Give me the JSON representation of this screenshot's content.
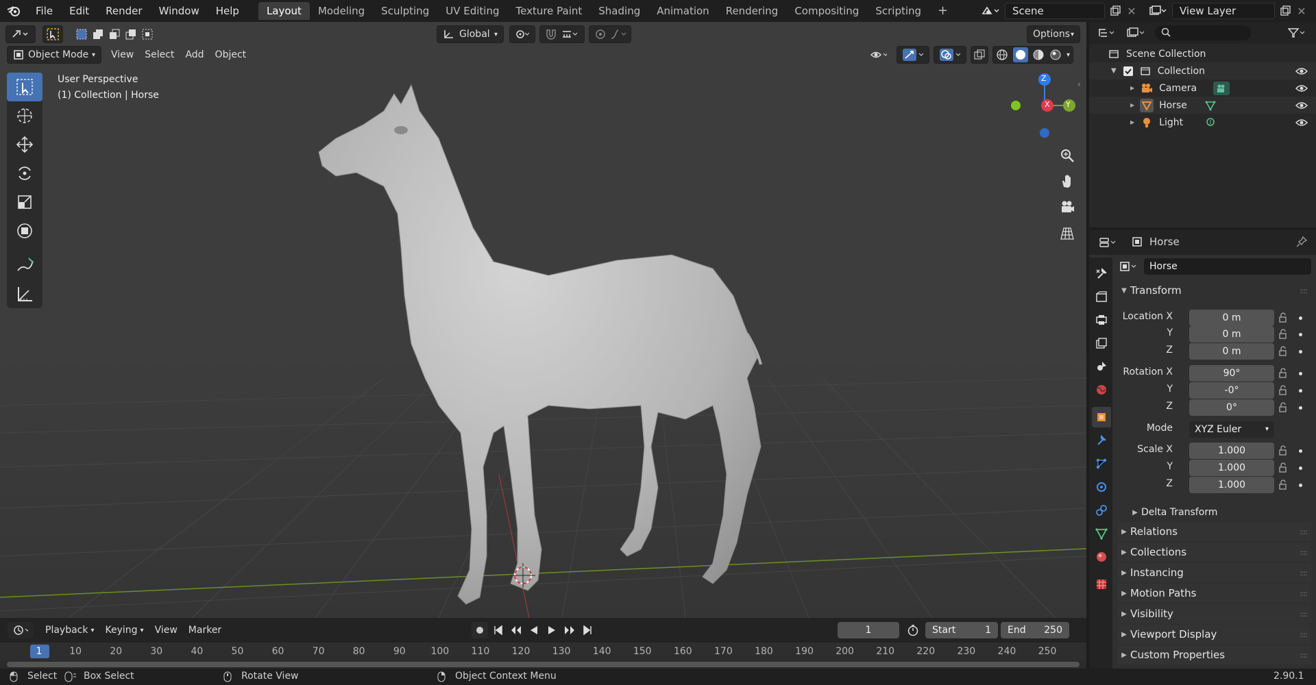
{
  "menu": [
    "File",
    "Edit",
    "Render",
    "Window",
    "Help"
  ],
  "workspace_tabs": [
    "Layout",
    "Modeling",
    "Sculpting",
    "UV Editing",
    "Texture Paint",
    "Shading",
    "Animation",
    "Rendering",
    "Compositing",
    "Scripting"
  ],
  "scene_name": "Scene",
  "view_layer": "View Layer",
  "viewport": {
    "mode": "Object Mode",
    "menus": [
      "View",
      "Select",
      "Add",
      "Object"
    ],
    "transform_orientation": "Global",
    "options_label": "Options",
    "overlay_title": "User Perspective",
    "overlay_subtitle": "(1) Collection | Horse",
    "gizmo_x": "X",
    "gizmo_y": "Y",
    "gizmo_z": "Z"
  },
  "timeline": {
    "menus": [
      "Playback",
      "Keying",
      "View",
      "Marker"
    ],
    "current_frame": "1",
    "start_label": "Start",
    "start_value": "1",
    "end_label": "End",
    "end_value": "250",
    "ruler": [
      "1",
      "10",
      "20",
      "30",
      "40",
      "50",
      "60",
      "70",
      "80",
      "90",
      "100",
      "110",
      "120",
      "130",
      "140",
      "150",
      "160",
      "170",
      "180",
      "190",
      "200",
      "210",
      "220",
      "230",
      "240",
      "250"
    ]
  },
  "statusbar": {
    "select": "Select",
    "box_select": "Box Select",
    "rotate_view": "Rotate View",
    "context_menu": "Object Context Menu",
    "version": "2.90.1"
  },
  "outliner": {
    "scene_collection": "Scene Collection",
    "collection": "Collection",
    "items": [
      "Camera",
      "Horse",
      "Light"
    ]
  },
  "properties": {
    "header_object": "Horse",
    "object_name": "Horse",
    "transform_label": "Transform",
    "location_label": "Location X",
    "rotation_label": "Rotation X",
    "scale_label": "Scale X",
    "y_label": "Y",
    "z_label": "Z",
    "location": [
      "0 m",
      "0 m",
      "0 m"
    ],
    "rotation": [
      "90°",
      "-0°",
      "0°"
    ],
    "mode_label": "Mode",
    "mode_value": "XYZ Euler",
    "scale": [
      "1.000",
      "1.000",
      "1.000"
    ],
    "delta_transform": "Delta Transform",
    "panels": [
      "Relations",
      "Collections",
      "Instancing",
      "Motion Paths",
      "Visibility",
      "Viewport Display",
      "Custom Properties"
    ]
  }
}
